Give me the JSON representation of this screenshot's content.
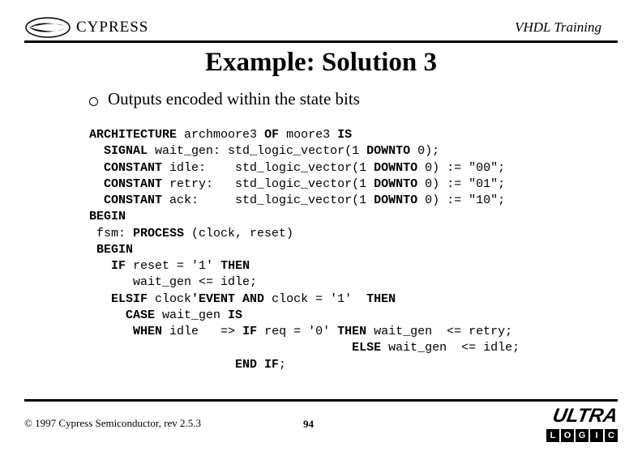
{
  "header": {
    "company": "CYPRESS",
    "label": "VHDL Training"
  },
  "title": "Example: Solution 3",
  "bullet": "Outputs encoded within the state bits",
  "code": {
    "l1a": "ARCHITECTURE",
    "l1b": " archmoore3 ",
    "l1c": "OF",
    "l1d": " moore3 ",
    "l1e": "IS",
    "l2a": "SIGNAL",
    "l2b": " wait_gen: std_logic_vector(1 ",
    "l2c": "DOWNTO",
    "l2d": " 0);",
    "l3a": "CONSTANT",
    "l3b": " idle:    std_logic_vector(1 ",
    "l3c": "DOWNTO",
    "l3d": " 0) := \"00\";",
    "l4a": "CONSTANT",
    "l4b": " retry:   std_logic_vector(1 ",
    "l4c": "DOWNTO",
    "l4d": " 0) := \"01\";",
    "l5a": "CONSTANT",
    "l5b": " ack:     std_logic_vector(1 ",
    "l5c": "DOWNTO",
    "l5d": " 0) := \"10\";",
    "l6a": "BEGIN",
    "l7a": " fsm: ",
    "l7b": "PROCESS",
    "l7c": " (clock, reset)",
    "l8a": "BEGIN",
    "l9a": "IF",
    "l9b": " reset = '1' ",
    "l9c": "THEN",
    "l10": "      wait_gen <= idle;",
    "l11a": "ELSIF",
    "l11b": " clock",
    "l11c": "'EVENT AND",
    "l11d": " clock = '1'  ",
    "l11e": "THEN",
    "l12a": "CASE",
    "l12b": " wait_gen ",
    "l12c": "IS",
    "l13a": "WHEN",
    "l13b": " idle   => ",
    "l13c": "IF",
    "l13d": " req = '0' ",
    "l13e": "THEN",
    "l13f": " wait_gen  <= retry;",
    "l14a": "ELSE",
    "l14b": " wait_gen  <= idle;",
    "l15a": "END IF",
    "l15b": ";"
  },
  "footer": {
    "copyright": "© 1997 Cypress Semiconductor, rev 2.5.3",
    "page": "94",
    "ultra": "ULTRA",
    "logic": [
      "L",
      "O",
      "G",
      "I",
      "C"
    ]
  }
}
